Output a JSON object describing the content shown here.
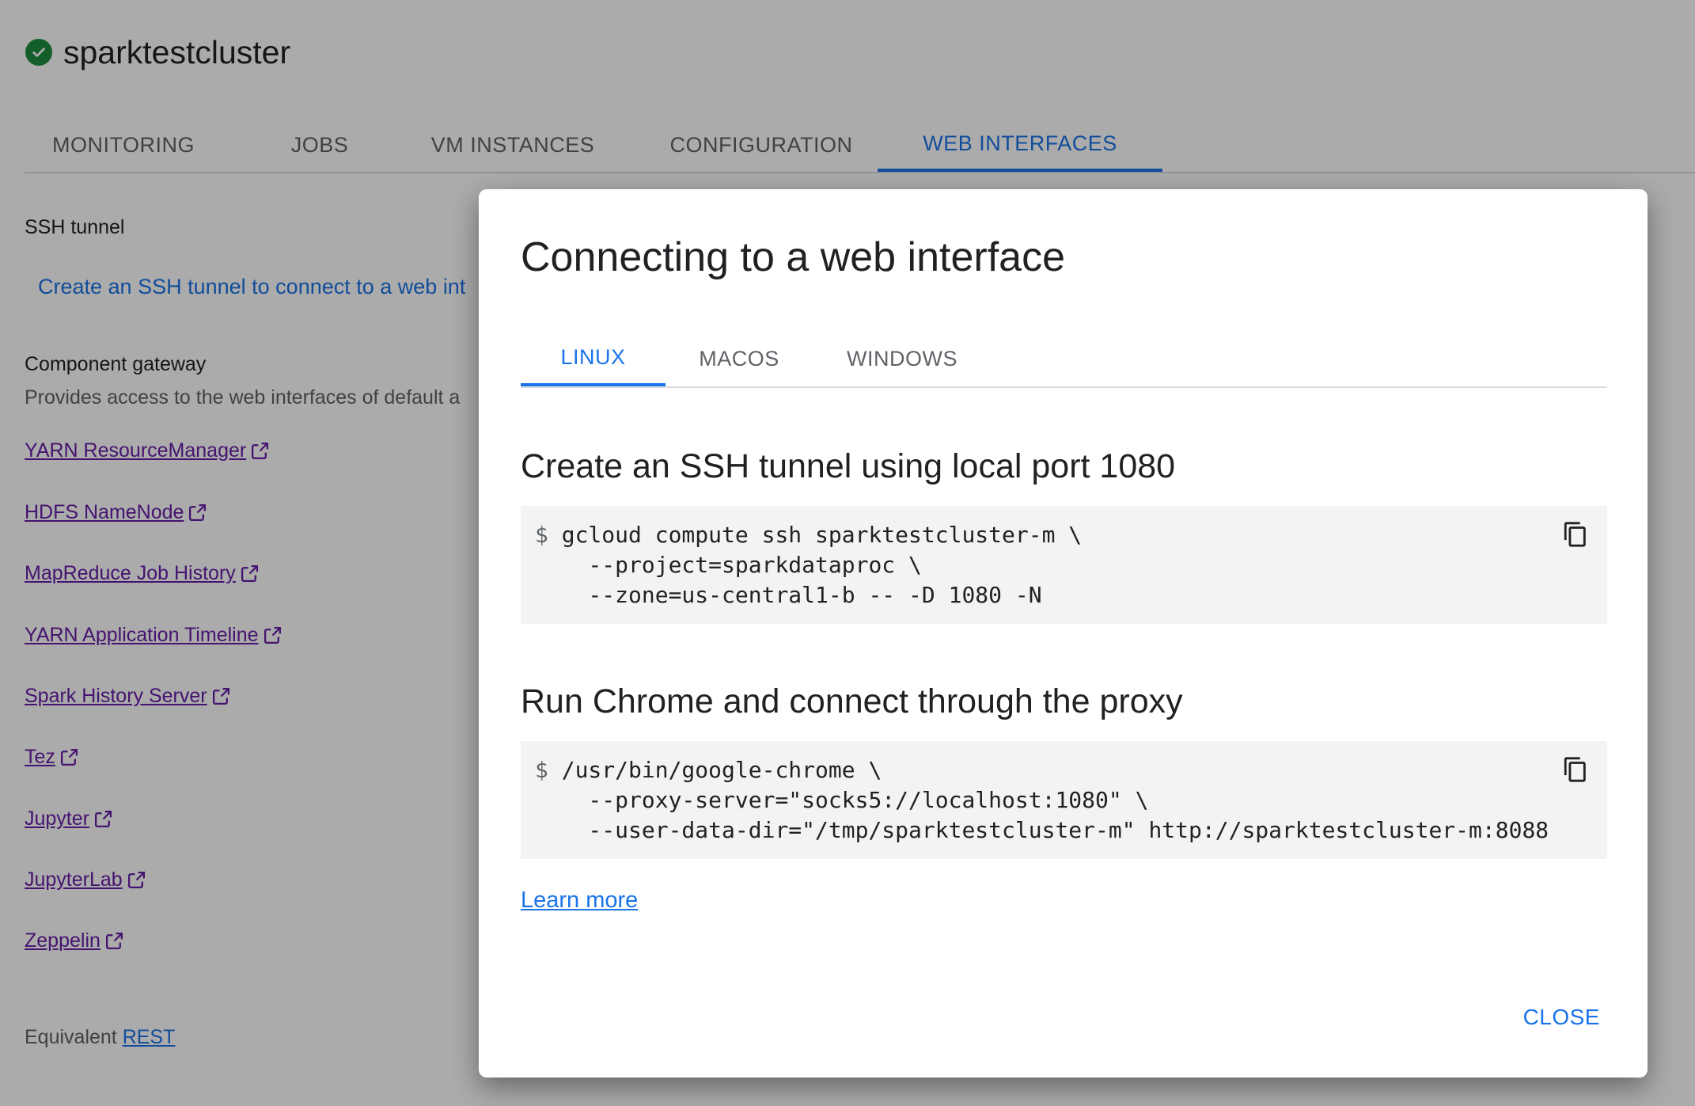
{
  "cluster": {
    "name": "sparktestcluster",
    "status_icon": "check-circle-icon"
  },
  "tabs": [
    {
      "label": "MONITORING"
    },
    {
      "label": "JOBS"
    },
    {
      "label": "VM INSTANCES"
    },
    {
      "label": "CONFIGURATION"
    },
    {
      "label": "WEB INTERFACES",
      "active": true
    }
  ],
  "ssh": {
    "heading": "SSH tunnel",
    "link": "Create an SSH tunnel to connect to a web int"
  },
  "gateway": {
    "heading": "Component gateway",
    "description": "Provides access to the web interfaces of default a",
    "links": [
      "YARN ResourceManager",
      "HDFS NameNode",
      "MapReduce Job History",
      "YARN Application Timeline",
      "Spark History Server",
      "Tez",
      "Jupyter",
      "JupyterLab",
      "Zeppelin"
    ]
  },
  "footer": {
    "equivalent": "Equivalent",
    "rest": "REST"
  },
  "dialog": {
    "title": "Connecting to a web interface",
    "tabs": [
      {
        "label": "LINUX",
        "active": true
      },
      {
        "label": "MACOS"
      },
      {
        "label": "WINDOWS"
      }
    ],
    "step1": {
      "heading": "Create an SSH tunnel using local port 1080",
      "prompt": "$",
      "lines": [
        "gcloud compute ssh sparktestcluster-m \\",
        "  --project=sparkdataproc \\",
        "  --zone=us-central1-b -- -D 1080 -N"
      ]
    },
    "step2": {
      "heading": "Run Chrome and connect through the proxy",
      "prompt": "$",
      "lines": [
        "/usr/bin/google-chrome \\",
        "  --proxy-server=\"socks5://localhost:1080\" \\",
        "  --user-data-dir=\"/tmp/sparktestcluster-m\" http://sparktestcluster-m:8088"
      ]
    },
    "learn_more": "Learn more",
    "close": "CLOSE"
  },
  "colors": {
    "accent": "#1a73e8",
    "visited_link": "#681da8",
    "status_green": "#1e8e3e",
    "scrim": "rgba(0,0,0,0.33)"
  }
}
